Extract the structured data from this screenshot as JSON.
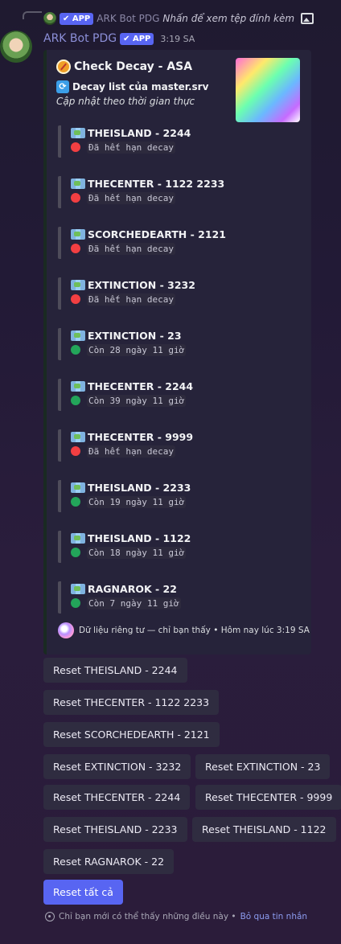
{
  "reply": {
    "app_badge": "✔ APP",
    "bot_name": "ARK Bot PDG",
    "text": "Nhấn để xem tệp đính kèm"
  },
  "message": {
    "bot_name": "ARK Bot PDG",
    "app_badge": "✔ APP",
    "time": "3:19 SA"
  },
  "embed": {
    "title": "Check Decay - ASA",
    "desc_title": "Decay list của master.srv",
    "desc_subtitle": "Cập nhật theo thời gian thực",
    "entries": [
      {
        "name": "THEISLAND - 2244",
        "status": "Đã hết hạn decay",
        "color": "#f23f42"
      },
      {
        "name": "THECENTER - 1122 2233",
        "status": "Đã hết hạn decay",
        "color": "#f23f42"
      },
      {
        "name": "SCORCHEDEARTH - 2121",
        "status": "Đã hết hạn decay",
        "color": "#f23f42"
      },
      {
        "name": "EXTINCTION - 3232",
        "status": "Đã hết hạn decay",
        "color": "#f23f42"
      },
      {
        "name": "EXTINCTION - 23",
        "status": "Còn 28 ngày 11 giờ",
        "color": "#23a55a"
      },
      {
        "name": "THECENTER - 2244",
        "status": "Còn 39 ngày 11 giờ",
        "color": "#23a55a"
      },
      {
        "name": "THECENTER - 9999",
        "status": "Đã hết hạn decay",
        "color": "#f23f42"
      },
      {
        "name": "THEISLAND - 2233",
        "status": "Còn 19 ngày 11 giờ",
        "color": "#23a55a"
      },
      {
        "name": "THEISLAND - 1122",
        "status": "Còn 18 ngày 11 giờ",
        "color": "#23a55a"
      },
      {
        "name": "RAGNAROK - 22",
        "status": "Còn 7 ngày 11 giờ",
        "color": "#23a55a"
      }
    ],
    "footer": "Dữ liệu riêng tư — chỉ bạn thấy • Hôm nay lúc 3:19 SA"
  },
  "buttons": {
    "reset_theisland_2244": "Reset THEISLAND - 2244",
    "reset_thecenter_1122_2233": "Reset THECENTER - 1122 2233",
    "reset_scorchedearth_2121": "Reset SCORCHEDEARTH - 2121",
    "reset_extinction_3232": "Reset EXTINCTION - 3232",
    "reset_extinction_23": "Reset EXTINCTION - 23",
    "reset_thecenter_2244": "Reset THECENTER - 2244",
    "reset_thecenter_9999": "Reset THECENTER - 9999",
    "reset_theisland_2233": "Reset THEISLAND - 2233",
    "reset_theisland_1122": "Reset THEISLAND - 1122",
    "reset_ragnarok_22": "Reset RAGNAROK - 22",
    "reset_all": "Reset tất cả"
  },
  "ephemeral": {
    "notice": "Chỉ bạn mới có thể thấy những điều này •",
    "dismiss": "Bỏ qua tin nhắn"
  }
}
